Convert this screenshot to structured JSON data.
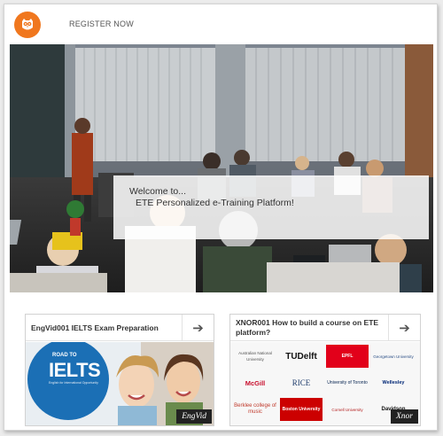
{
  "header": {
    "register_label": "REGISTER NOW"
  },
  "hero": {
    "welcome_line1": "Welcome to...",
    "welcome_line2": "ETE Personalized e-Training Platform!"
  },
  "courses": [
    {
      "title": "EngVid001 IELTS Exam Preparation",
      "image_text_top": "ROAD TO",
      "image_text_main": "IELTS",
      "image_text_sub": "English for International Opportunity",
      "badge": "EngVid"
    },
    {
      "title": "XNOR001 How to build a course on ETE platform?",
      "badge": "Xnor",
      "university_logos": [
        "Australian National University",
        "TUDelft",
        "EPFL",
        "Georgetown University",
        "McGill",
        "RICE",
        "University of Toronto",
        "Wellesley",
        "Berklee college of music",
        "Boston University",
        "Cornell University",
        "Davidson"
      ]
    }
  ],
  "colors": {
    "brand_orange": "#f0771e",
    "ielts_blue": "#1b6fb5",
    "epfl_red": "#e2001a",
    "mcgill_red": "#c8102e"
  },
  "icons": {
    "logo": "owl-icon",
    "card_arrow": "arrow-right-icon"
  }
}
